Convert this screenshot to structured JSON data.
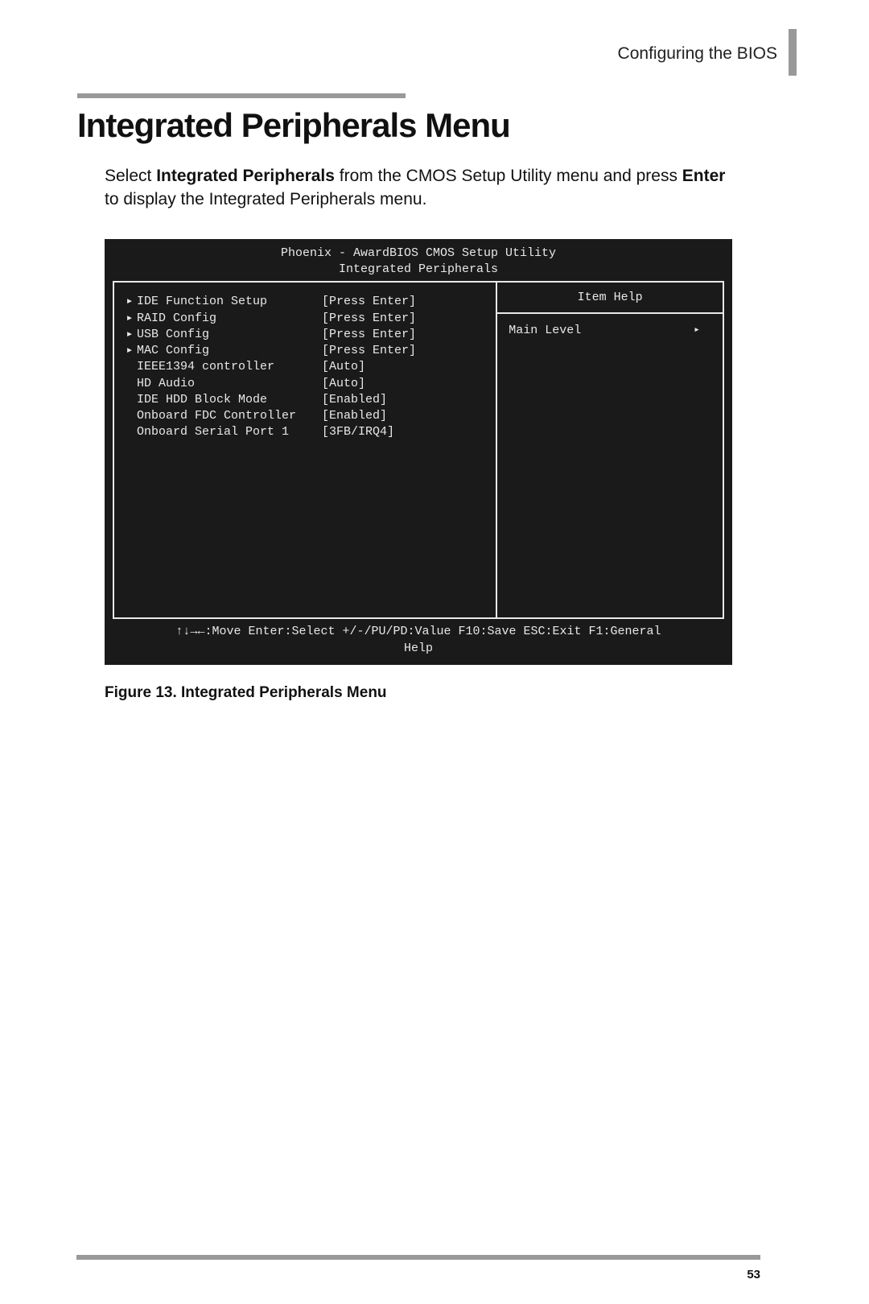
{
  "header": {
    "chapter": "Configuring the BIOS"
  },
  "section": {
    "title": "Integrated Peripherals Menu",
    "intro_pre": "Select ",
    "intro_b1": "Integrated Peripherals",
    "intro_mid": " from the CMOS Setup Utility menu and press ",
    "intro_b2": "Enter",
    "intro_post": " to display the Integrated Peripherals menu."
  },
  "bios": {
    "title_line1": "Phoenix - AwardBIOS CMOS Setup Utility",
    "title_line2": "Integrated Peripherals",
    "items": [
      {
        "caret": "▸",
        "label": "IDE Function Setup",
        "value": "[Press Enter]"
      },
      {
        "caret": "▸",
        "label": "RAID Config",
        "value": "[Press Enter]"
      },
      {
        "caret": "▸",
        "label": "USB Config",
        "value": "[Press Enter]"
      },
      {
        "caret": "▸",
        "label": "MAC Config",
        "value": "[Press Enter]"
      },
      {
        "caret": "",
        "label": "IEEE1394 controller",
        "value": "[Auto]"
      },
      {
        "caret": "",
        "label": "HD Audio",
        "value": "[Auto]"
      },
      {
        "caret": "",
        "label": "IDE HDD Block Mode",
        "value": "[Enabled]"
      },
      {
        "caret": "",
        "label": "Onboard FDC Controller",
        "value": "[Enabled]"
      },
      {
        "caret": "",
        "label": "Onboard Serial Port 1",
        "value": "[3FB/IRQ4]"
      }
    ],
    "help_header": "Item Help",
    "help_main_level": "Main Level",
    "footer_line1": "↑↓→←:Move  Enter:Select  +/-/PU/PD:Value  F10:Save  ESC:Exit  F1:General",
    "footer_line2": "Help"
  },
  "figure_caption": "Figure 13. Integrated Peripherals Menu",
  "page_number": "53"
}
